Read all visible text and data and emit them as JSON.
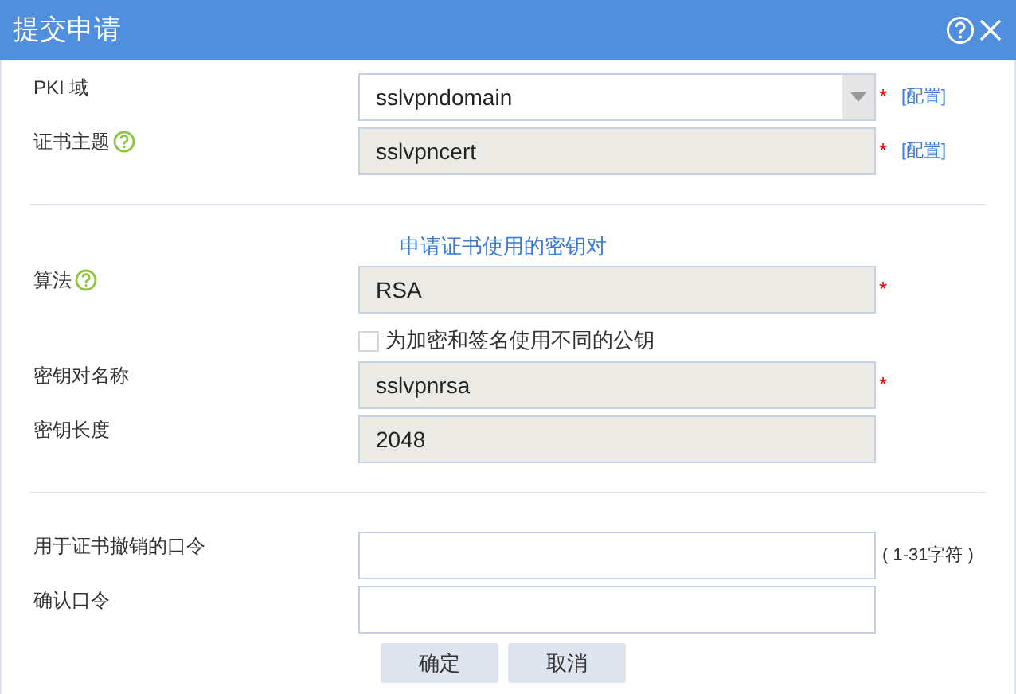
{
  "window": {
    "title": "提交申请"
  },
  "sections": [
    {
      "rows": [
        {
          "kind": "select",
          "label": "PKI 域",
          "help": false,
          "value": "sslvpndomain",
          "disabled": false,
          "required_mark": "*",
          "link": "[配置]"
        },
        {
          "kind": "text",
          "label": "证书主题",
          "help": true,
          "value": "sslvpncert",
          "disabled": true,
          "required_mark": "*",
          "link": "[配置]"
        }
      ]
    },
    {
      "heading": "申请证书使用的密钥对",
      "rows": [
        {
          "kind": "text",
          "label": "算法",
          "help": true,
          "value": "RSA",
          "disabled": true,
          "required_mark": "*"
        },
        {
          "kind": "checkbox",
          "label": "为加密和签名使用不同的公钥",
          "checked": false
        },
        {
          "kind": "text",
          "label": "密钥对名称",
          "help": false,
          "value": "sslvpnrsa",
          "disabled": true,
          "required_mark": "*"
        },
        {
          "kind": "text",
          "label": "密钥长度",
          "help": false,
          "value": "2048",
          "disabled": true
        }
      ]
    },
    {
      "rows": [
        {
          "kind": "text",
          "label": "用于证书撤销的口令",
          "help": false,
          "value": "",
          "disabled": false,
          "hint": "( 1-31字符 )"
        },
        {
          "kind": "text",
          "label": "确认口令",
          "help": false,
          "value": "",
          "disabled": false
        }
      ]
    }
  ],
  "buttons": [
    "确定",
    "取消"
  ]
}
